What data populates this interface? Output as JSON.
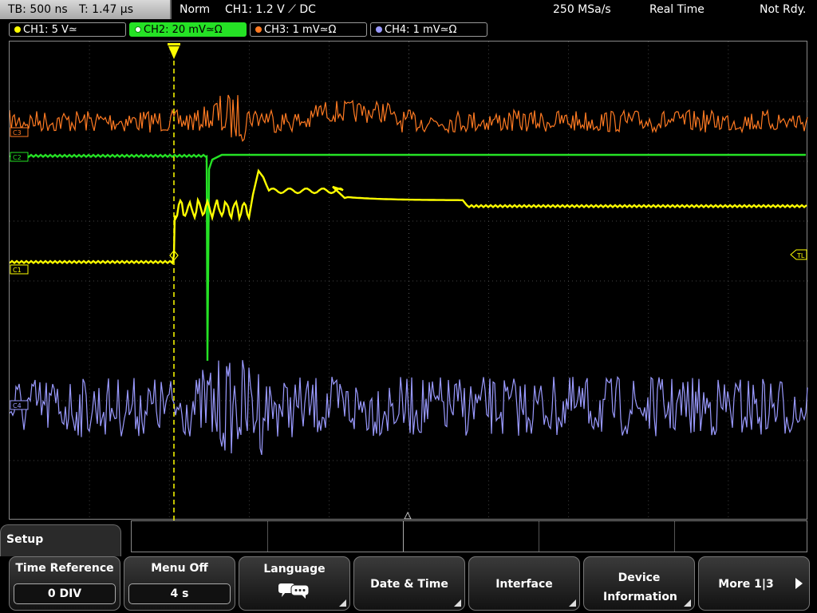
{
  "topbar": {
    "timebase": "TB: 500 ns",
    "trigger_time": "T: 1.47 µs",
    "mode": "Norm",
    "trigger_info": "CH1: 1.2 V ⟋ DC",
    "sample_rate": "250 MSa/s",
    "acq_mode": "Real Time",
    "status": "Not Rdy."
  },
  "channels": [
    {
      "label": "CH1: 5 V≃",
      "color": "#ffff00",
      "active": false
    },
    {
      "label": "CH2: 20 mV≃Ω",
      "color": "#25e225",
      "active": true
    },
    {
      "label": "CH3: 1 mV≃Ω",
      "color": "#ff7a22",
      "active": false
    },
    {
      "label": "CH4: 1 mV≃Ω",
      "color": "#9a9aff",
      "active": false
    }
  ],
  "markers": {
    "ch1": "C1",
    "ch2": "C2",
    "ch3": "C3",
    "ch4": "C4",
    "trigger_level": "TL",
    "trigger": "T"
  },
  "setup": {
    "title": "Setup"
  },
  "softkeys": [
    {
      "title": "Time Reference",
      "value": "0 DIV",
      "icon": "none"
    },
    {
      "title": "Menu Off",
      "value": "4 s",
      "icon": "none"
    },
    {
      "title": "Language",
      "value": "",
      "icon": "speech-bubbles-icon"
    },
    {
      "title": "Date & Time",
      "value": "",
      "icon": "submenu-corner-icon"
    },
    {
      "title": "Interface",
      "value": "",
      "icon": "submenu-corner-icon"
    },
    {
      "title": "Device Information",
      "value": "",
      "icon": "submenu-corner-icon"
    },
    {
      "title": "More 1|3",
      "value": "",
      "icon": "right-arrow-icon"
    }
  ],
  "colors": {
    "ch1": "#ffff00",
    "ch2": "#25e225",
    "ch3": "#ff7a22",
    "ch4": "#9a9aff",
    "grid": "#5a5a5a"
  }
}
